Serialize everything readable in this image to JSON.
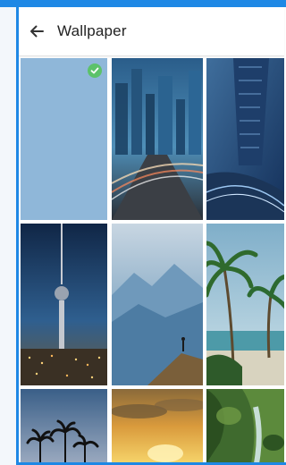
{
  "header": {
    "title": "Wallpaper"
  },
  "icons": {
    "back": "arrow-left-icon",
    "selected": "check-circle-icon"
  },
  "colors": {
    "accent": "#1e88e5",
    "selected_badge": "#5cc26a",
    "plain_wallpaper": "#8fb7d9"
  },
  "wallpapers": [
    {
      "name": "plain-blue",
      "selected": true
    },
    {
      "name": "city-road-night",
      "selected": false
    },
    {
      "name": "skyscraper-blue",
      "selected": false
    },
    {
      "name": "tv-tower-night",
      "selected": false
    },
    {
      "name": "mountain-hiker",
      "selected": false
    },
    {
      "name": "palm-beach",
      "selected": false
    },
    {
      "name": "palm-sunset",
      "selected": false
    },
    {
      "name": "sunset-clouds",
      "selected": false
    },
    {
      "name": "jungle-waterfall",
      "selected": false
    }
  ]
}
